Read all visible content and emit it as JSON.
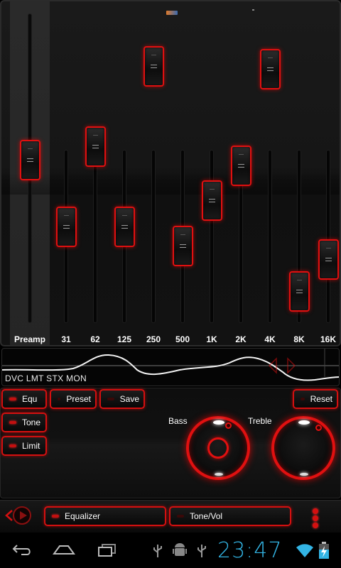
{
  "equalizer": {
    "bands": [
      {
        "label": "Preamp",
        "level": 0.53
      },
      {
        "label": "31",
        "level": 0.28
      },
      {
        "label": "62",
        "level": 0.58
      },
      {
        "label": "125",
        "level": 0.28
      },
      {
        "label": "250",
        "level": 0.88
      },
      {
        "label": "500",
        "level": 0.21
      },
      {
        "label": "1K",
        "level": 0.38
      },
      {
        "label": "2K",
        "level": 0.51
      },
      {
        "label": "4K",
        "level": 0.87
      },
      {
        "label": "8K",
        "level": 0.04
      },
      {
        "label": "16K",
        "level": 0.16
      }
    ]
  },
  "visualizer": {
    "status": "DVC LMT STX MON"
  },
  "controls": {
    "equ_label": "Equ",
    "preset_label": "Preset",
    "save_label": "Save",
    "reset_label": "Reset",
    "tone_label": "Tone",
    "limit_label": "Limit",
    "bass_label": "Bass",
    "treble_label": "Treble"
  },
  "nav": {
    "equalizer_label": "Equalizer",
    "tone_vol_label": "Tone/Vol"
  },
  "system": {
    "clock": "23:47",
    "clock_color": "#33b5e5"
  },
  "theme": {
    "accent": "#e01010"
  }
}
